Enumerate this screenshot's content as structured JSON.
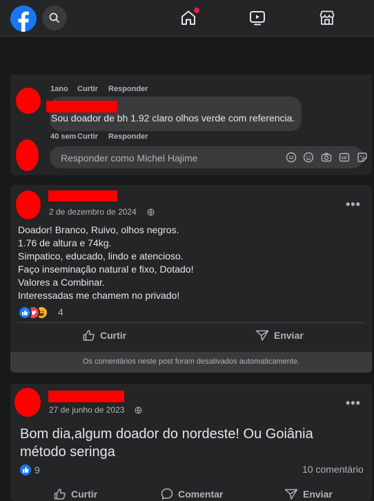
{
  "nav": {
    "logo": "facebook-logo",
    "icons": [
      "search-icon",
      "home-icon",
      "watch-icon",
      "marketplace-icon"
    ],
    "home_has_notification": true,
    "colors": {
      "brand": "#1877f2",
      "notification": "#e41e3f",
      "redaction": "#ff0000"
    }
  },
  "comments": {
    "first": {
      "age": "1ano",
      "like": "Curtir",
      "reply": "Responder"
    },
    "second": {
      "text": "Sou doador de bh 1.92 claro olhos verde com referencia.",
      "age": "40 sem",
      "like": "Curtir",
      "reply": "Responder"
    },
    "reply_placeholder": "Responder como Michel Hajime",
    "reply_icons": [
      "avatar-sticker-icon",
      "emoji-icon",
      "camera-icon",
      "gif-icon",
      "sticker-icon"
    ]
  },
  "post1": {
    "date": "2 de dezembro de 2024",
    "more": "•••",
    "lines": [
      "Doador! Branco, Ruivo, olhos negros.",
      "1.76 de altura e 74kg.",
      "Simpatico, educado, lindo e atencioso.",
      "Faço inseminação natural e fixo, Dotado!",
      "Valores a Combinar.",
      "Interessadas me chamem no privado!"
    ],
    "reactions": [
      "like",
      "love",
      "haha"
    ],
    "reaction_count": "4",
    "like_label": "Curtir",
    "send_label": "Enviar",
    "comments_disabled": "Os comentários neste post foram desativados automaticamente."
  },
  "post2": {
    "date": "27 de junho de 2023",
    "more": "•••",
    "lines": [
      "Bom dia,algum doador do nordeste! Ou Goiânia",
      "método seringa"
    ],
    "reactions": [
      "like"
    ],
    "reaction_count": "9",
    "comment_count": "10 comentário",
    "like_label": "Curtir",
    "comment_label": "Comentar",
    "send_label": "Enviar"
  }
}
